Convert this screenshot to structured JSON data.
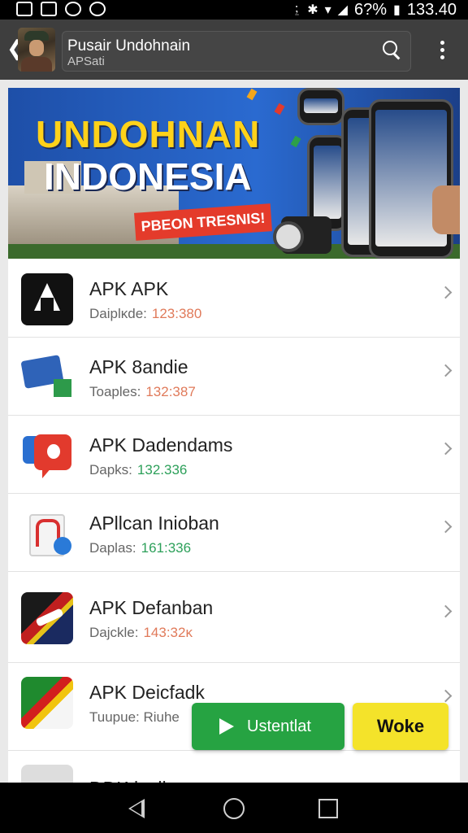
{
  "status_bar": {
    "battery": "6?%",
    "time": "133.40"
  },
  "app_bar": {
    "title": "Pusair Undohnain",
    "subtitle": "APSati"
  },
  "banner": {
    "line1": "UNDOHNAN",
    "line2": "INDONESIA",
    "ribbon": "PBEON TRESNIS!"
  },
  "list": [
    {
      "name": "APK APK",
      "meta_label": "Daiplĸde:",
      "meta_value": "123:380",
      "meta_color": "#e07a5a"
    },
    {
      "name": "APK 8andie",
      "meta_label": "Toaples:",
      "meta_value": "132:387",
      "meta_color": "#e07a5a"
    },
    {
      "name": "APK Dadendams",
      "meta_label": "Dapks:",
      "meta_value": "132.336",
      "meta_color": "#2da05a"
    },
    {
      "name": "APllcan Inioban",
      "meta_label": "Daplas:",
      "meta_value": "161:336",
      "meta_color": "#2da05a"
    },
    {
      "name": "APK Defanban",
      "meta_label": "Dajckle:",
      "meta_value": "143:32ĸ",
      "meta_color": "#e07a5a"
    },
    {
      "name": "APK Deicfadk",
      "meta_label": "Tuupue: Riuhe",
      "meta_value": "",
      "meta_color": "#666666"
    }
  ],
  "partial_row": {
    "name": "DDK lusih..."
  },
  "buttons": {
    "primary_label": "Ustentlat",
    "secondary_label": "Woke"
  },
  "colors": {
    "app_bar": "#3e3e3e",
    "banner": "#2a6ad0",
    "primary_button": "#26a342",
    "secondary_button": "#f4e32a"
  }
}
